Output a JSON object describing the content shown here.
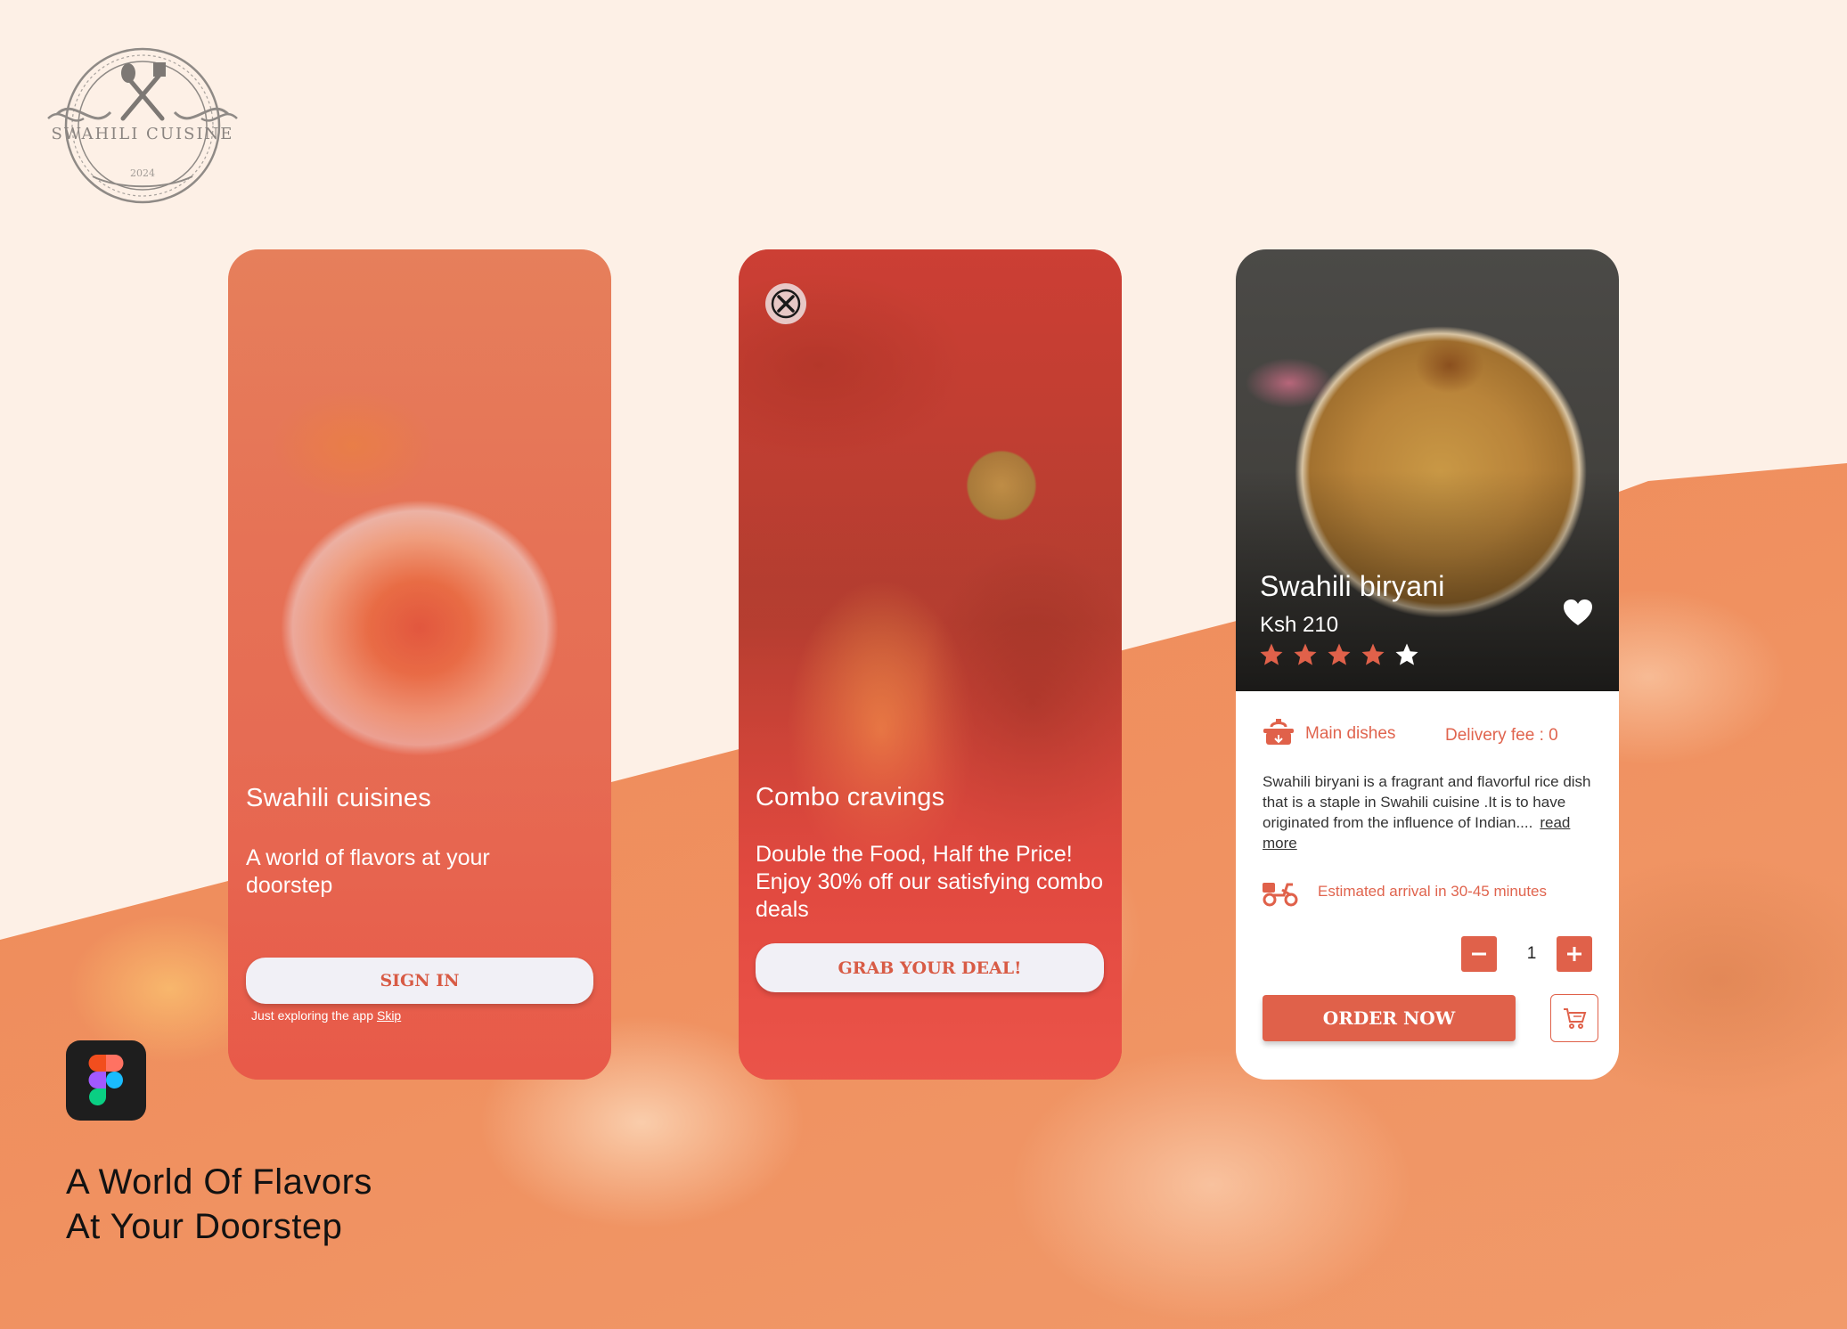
{
  "brand": {
    "logo_text": "SWAHILI CUISINE",
    "logo_year": "2024",
    "logo_icon": "crossed-utensils-icon"
  },
  "screens": {
    "welcome": {
      "title": "Swahili cuisines",
      "subtitle": "A world of flavors at your doorstep",
      "button_label": "SIGN IN",
      "skip_prefix": "Just exploring the app",
      "skip_link": "Skip"
    },
    "promo": {
      "close_icon": "close-icon",
      "title": "Combo cravings",
      "subtitle": "Double the Food, Half the Price! Enjoy 30% off our satisfying combo deals",
      "button_label": "GRAB YOUR DEAL!"
    },
    "detail": {
      "dish_name": "Swahili biryani",
      "price": "Ksh 210",
      "rating": 4,
      "rating_max": 5,
      "category": "Main dishes",
      "delivery_fee": "Delivery fee : 0",
      "description": "Swahili biryani is a fragrant and flavorful rice dish that is a staple in Swahili cuisine .It is  to have originated from the influence of Indian....",
      "read_more": "read more",
      "eta": "Estimated arrival in 30-45 minutes",
      "quantity": "1",
      "order_button": "ORDER NOW"
    }
  },
  "footer": {
    "tool_icon": "figma-icon",
    "tagline_line1": "A World Of Flavors",
    "tagline_line2": "At Your Doorstep"
  },
  "colors": {
    "background": "#fdf0e6",
    "accent": "#e0614a",
    "button_bg": "#f1f0f6"
  }
}
